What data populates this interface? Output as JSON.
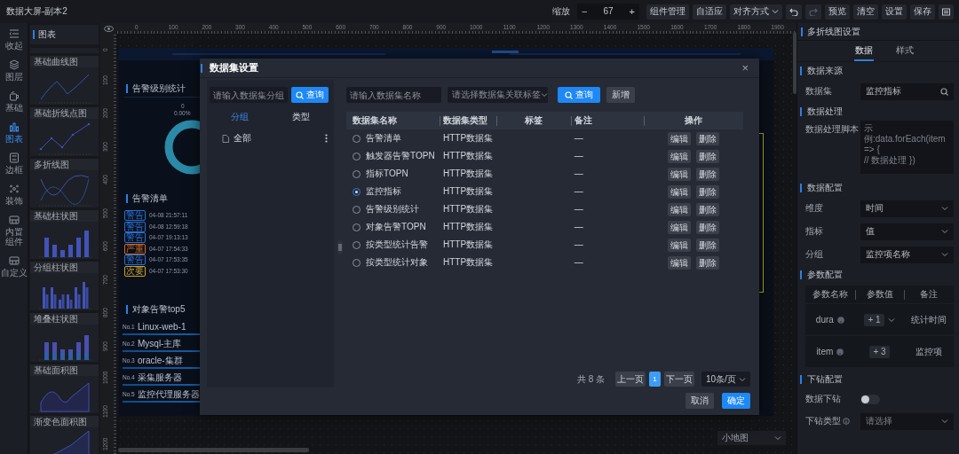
{
  "app_title": "数据大屏-副本2",
  "toolbar": {
    "zoom_label": "缩放",
    "zoom_minus": "−",
    "zoom_value": "67",
    "zoom_plus": "+",
    "items": [
      {
        "kind": "button",
        "label": "组件管理",
        "disabled": false
      },
      {
        "kind": "button",
        "label": "自适应",
        "disabled": false
      },
      {
        "kind": "dropdown",
        "label": "对齐方式",
        "disabled": false
      },
      {
        "kind": "undo",
        "disabled": false
      },
      {
        "kind": "redo",
        "disabled": true
      },
      {
        "kind": "button",
        "label": "预览",
        "disabled": false
      },
      {
        "kind": "button",
        "label": "清空",
        "disabled": false
      },
      {
        "kind": "button",
        "label": "设置",
        "disabled": false
      },
      {
        "kind": "button",
        "label": "保存",
        "disabled": false
      },
      {
        "kind": "menu",
        "disabled": false
      }
    ]
  },
  "rail": [
    {
      "kind": "collapse",
      "label": "收起",
      "selected": false
    },
    {
      "kind": "layers",
      "label": "图层",
      "selected": false
    },
    {
      "kind": "basic",
      "label": "基础",
      "selected": false
    },
    {
      "kind": "chart",
      "label": "图表",
      "selected": true
    },
    {
      "kind": "border",
      "label": "边框",
      "selected": false
    },
    {
      "kind": "decor",
      "label": "装饰",
      "selected": false
    },
    {
      "kind": "builtin",
      "label": "内置组件",
      "selected": false
    },
    {
      "kind": "custom",
      "label": "自定义",
      "selected": false
    }
  ],
  "palette": {
    "title": "图表",
    "items": [
      {
        "kind": "curve",
        "label": "基础曲线图"
      },
      {
        "kind": "line-dots",
        "label": "基础折线点图"
      },
      {
        "kind": "multi-line",
        "label": "多折线图"
      },
      {
        "kind": "bar",
        "label": "基础柱状图"
      },
      {
        "kind": "grouped-bar",
        "label": "分组柱状图"
      },
      {
        "kind": "stacked-bar",
        "label": "堆叠柱状图"
      },
      {
        "kind": "area",
        "label": "基础面积图"
      },
      {
        "kind": "gradient-area",
        "label": "渐变色面积图"
      }
    ]
  },
  "ruler": {
    "x_labels": [
      "0",
      "100",
      "200",
      "300",
      "400",
      "500",
      "600",
      "700",
      "800",
      "900",
      "1000",
      "1100",
      "1200",
      "1300",
      "1400",
      "1500",
      "1600",
      "1700",
      "1800",
      "1900"
    ],
    "y_labels": [
      "0",
      "100",
      "200",
      "300",
      "400",
      "500",
      "600",
      "700",
      "800",
      "900",
      "1000",
      "1100",
      "1200"
    ]
  },
  "dashboard": {
    "alarm_level": {
      "title": "告警级别统计",
      "labels": [
        "0",
        "0.00%"
      ]
    },
    "alarm_list": {
      "title": "告警清单",
      "rows": [
        {
          "tag": "警告",
          "color": "#2a6fd1",
          "time": "04-08 21:57:11"
        },
        {
          "tag": "警告",
          "color": "#2a6fd1",
          "time": "04-08 12:59:18"
        },
        {
          "tag": "警告",
          "color": "#2a6fd1",
          "time": "04-07 19:13:13"
        },
        {
          "tag": "严重",
          "color": "#d2691e",
          "time": "04-07 17:54:33"
        },
        {
          "tag": "警告",
          "color": "#2a6fd1",
          "time": "04-07 17:53:35"
        },
        {
          "tag": "次要",
          "color": "#c9a227",
          "time": "04-07 17:53:30"
        }
      ]
    },
    "top5": {
      "title": "对象告警top5",
      "items": [
        {
          "rank": "No.1",
          "name": "Linux-web-1"
        },
        {
          "rank": "No.2",
          "name": "Mysql-主库"
        },
        {
          "rank": "No.3",
          "name": "oracle-集群"
        },
        {
          "rank": "No.4",
          "name": "采集服务器"
        },
        {
          "rank": "No.5",
          "name": "监控代理服务器"
        }
      ]
    }
  },
  "minimap": {
    "label": "小地图"
  },
  "dialog": {
    "title": "数据集设置",
    "close": "×",
    "group_pane": {
      "search_placeholder": "请输入数据集分组",
      "search_button": "查询",
      "tabs": [
        {
          "label": "分组",
          "selected": true
        },
        {
          "label": "类型",
          "selected": false
        }
      ],
      "tree": [
        {
          "label": "全部"
        }
      ]
    },
    "filters": {
      "name_placeholder": "请输入数据集名称",
      "tag_placeholder": "请选择数据集关联标签",
      "search_button": "查询",
      "add_button": "新增"
    },
    "table": {
      "columns": [
        "数据集名称",
        "数据集类型",
        "标签",
        "备注",
        "操作"
      ],
      "rows": [
        {
          "name": "告警清单",
          "type": "HTTP数据集",
          "note": "—",
          "selected": false,
          "actions": [
            "编辑",
            "删除"
          ]
        },
        {
          "name": "触发器告警TOPN",
          "type": "HTTP数据集",
          "note": "—",
          "selected": false,
          "actions": [
            "编辑",
            "删除"
          ]
        },
        {
          "name": "指标TOPN",
          "type": "HTTP数据集",
          "note": "—",
          "selected": false,
          "actions": [
            "编辑",
            "删除"
          ]
        },
        {
          "name": "监控指标",
          "type": "HTTP数据集",
          "note": "—",
          "selected": true,
          "actions": [
            "编辑",
            "删除"
          ]
        },
        {
          "name": "告警级别统计",
          "type": "HTTP数据集",
          "note": "—",
          "selected": false,
          "actions": [
            "编辑",
            "删除"
          ]
        },
        {
          "name": "对象告警TOPN",
          "type": "HTTP数据集",
          "note": "—",
          "selected": false,
          "actions": [
            "编辑",
            "删除"
          ]
        },
        {
          "name": "按类型统计告警",
          "type": "HTTP数据集",
          "note": "—",
          "selected": false,
          "actions": [
            "编辑",
            "删除"
          ]
        },
        {
          "name": "按类型统计对象",
          "type": "HTTP数据集",
          "note": "—",
          "selected": false,
          "actions": [
            "编辑",
            "删除"
          ]
        }
      ]
    },
    "pagination": {
      "total": "共 8 条",
      "prev": "上一页",
      "pages": [
        {
          "label": "1",
          "selected": true
        }
      ],
      "next": "下一页",
      "page_size": "10条/页"
    },
    "footer": {
      "cancel": "取消",
      "ok": "确定"
    }
  },
  "settings": {
    "title": "多折线图设置",
    "tabs": [
      {
        "label": "数据",
        "selected": true
      },
      {
        "label": "样式",
        "selected": false
      }
    ],
    "blocks": [
      {
        "kind": "section",
        "label": "数据来源"
      },
      {
        "kind": "search",
        "label": "数据集",
        "value": "监控指标"
      },
      {
        "kind": "section",
        "label": "数据处理"
      },
      {
        "kind": "script",
        "label": "数据处理脚本",
        "placeholder": "示例:data.forEach(item => {\n// 数据处理 })"
      },
      {
        "kind": "section",
        "label": "数据配置"
      },
      {
        "kind": "select",
        "label": "维度",
        "value": "时间"
      },
      {
        "kind": "select",
        "label": "指标",
        "value": "值"
      },
      {
        "kind": "select",
        "label": "分组",
        "value": "监控项名称"
      },
      {
        "kind": "section",
        "label": "参数配置"
      },
      {
        "kind": "params",
        "columns": [
          "参数名称",
          "参数值",
          "备注"
        ],
        "rows": [
          {
            "name": "dura",
            "value": "+ 1",
            "dropdown": true,
            "note": "统计时间"
          },
          {
            "name": "item",
            "value": "+ 3",
            "dropdown": false,
            "note": "监控项"
          }
        ]
      },
      {
        "kind": "section",
        "label": "下钻配置"
      },
      {
        "kind": "toggle",
        "label": "数据下钻",
        "on": false
      },
      {
        "kind": "select",
        "label": "下钻类型",
        "info": true,
        "placeholder": "请选择"
      }
    ]
  }
}
